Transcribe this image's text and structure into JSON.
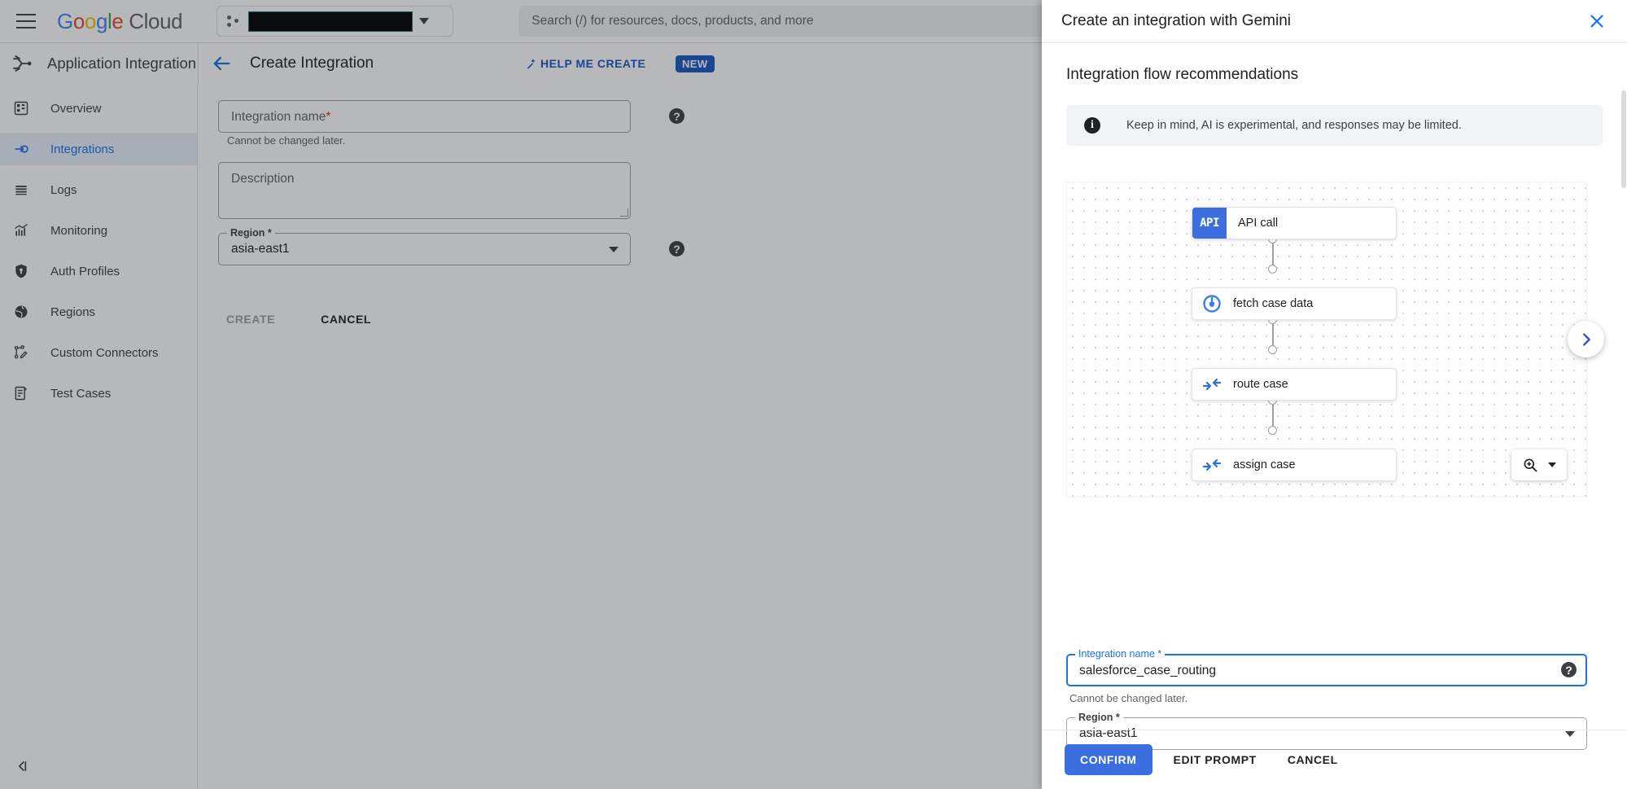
{
  "topbar": {
    "menu_icon": "hamburger-icon",
    "logo_google": "Google",
    "logo_cloud": "Cloud",
    "project_picker_icon": "project-selector-icon",
    "project_name": "",
    "search_placeholder": "Search (/) for resources, docs, products, and more"
  },
  "product_header": {
    "product_icon": "application-integration-icon",
    "product_name": "Application Integration",
    "back_icon": "back-arrow-icon",
    "page_title": "Create Integration",
    "help_me_create_icon": "magic-wand-icon",
    "help_me_create_label": "HELP ME CREATE",
    "new_badge": "NEW"
  },
  "sidebar": {
    "collapse_icon": "collapse-panel-icon",
    "items": [
      {
        "label": "Overview",
        "icon": "dashboard-icon",
        "active": false
      },
      {
        "label": "Integrations",
        "icon": "integrations-icon",
        "active": true
      },
      {
        "label": "Logs",
        "icon": "logs-icon",
        "active": false
      },
      {
        "label": "Monitoring",
        "icon": "monitoring-chart-icon",
        "active": false
      },
      {
        "label": "Auth Profiles",
        "icon": "shield-key-icon",
        "active": false
      },
      {
        "label": "Regions",
        "icon": "globe-icon",
        "active": false
      },
      {
        "label": "Custom Connectors",
        "icon": "custom-connectors-icon",
        "active": false
      },
      {
        "label": "Test Cases",
        "icon": "test-cases-icon",
        "active": false
      }
    ]
  },
  "background_form": {
    "name_placeholder": "Integration name",
    "required_mark": "*",
    "name_helper": "Cannot be changed later.",
    "name_help_icon": "help-icon",
    "description_placeholder": "Description",
    "region_label": "Region *",
    "region_value": "asia-east1",
    "region_help_icon": "help-icon",
    "create_label": "CREATE",
    "cancel_label": "CANCEL"
  },
  "panel": {
    "title": "Create an integration with Gemini",
    "close_icon": "close-icon",
    "section_title": "Integration flow recommendations",
    "info_icon": "info-icon",
    "info_text": "Keep in mind, AI is experimental, and responses may be limited.",
    "next_icon": "chevron-right-icon",
    "zoom_icon": "zoom-in-icon",
    "zoom_caret_icon": "chevron-down-icon",
    "name_label": "Integration name *",
    "name_value": "salesforce_case_routing",
    "name_help_icon": "help-icon",
    "name_helper": "Cannot be changed later.",
    "region_label": "Region *",
    "region_value": "asia-east1",
    "region_caret_icon": "chevron-down-icon",
    "confirm_label": "CONFIRM",
    "edit_prompt_label": "EDIT PROMPT",
    "cancel_label": "CANCEL",
    "flow_nodes": [
      {
        "label": "API call",
        "icon": "api-icon",
        "chip": "API"
      },
      {
        "label": "fetch case data",
        "icon": "connector-plug-icon",
        "chip": ""
      },
      {
        "label": "route case",
        "icon": "data-mapping-icon",
        "chip": ""
      },
      {
        "label": "assign case",
        "icon": "data-mapping-icon",
        "chip": ""
      }
    ]
  },
  "colors": {
    "accent_blue": "#1a73e8",
    "button_blue": "#3b6fe0",
    "required_red": "#d93025",
    "active_nav_bg": "#e8f0fe"
  }
}
